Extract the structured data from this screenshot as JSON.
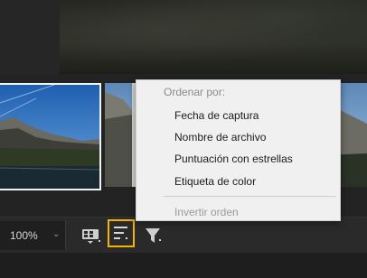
{
  "toolbar": {
    "zoom_value": "100%",
    "zoom_dropdown_icon": "chevron-down-icon",
    "thumbnail_view_icon": "thumbnail-view-icon",
    "sort_icon": "sort-icon",
    "filter_icon": "filter-icon",
    "sort_highlight_color": "#f5b400"
  },
  "sort_menu": {
    "header": "Ordenar por:",
    "items": [
      {
        "label": "Fecha de captura"
      },
      {
        "label": "Nombre de archivo"
      },
      {
        "label": "Puntuación con estrellas"
      },
      {
        "label": "Etiqueta de color"
      }
    ],
    "reverse_order": "Invertir orden",
    "reverse_order_enabled": false
  }
}
